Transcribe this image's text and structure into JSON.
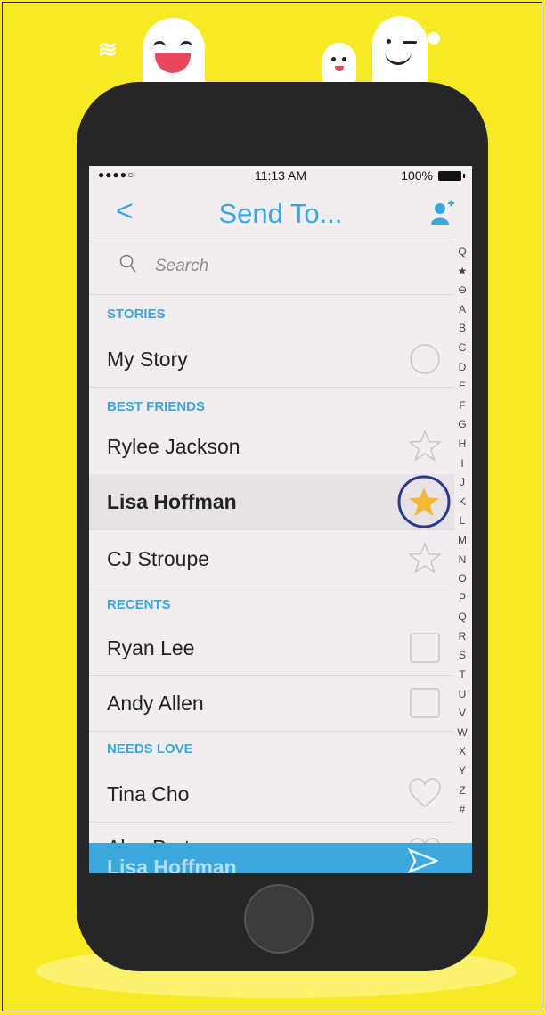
{
  "status_bar": {
    "signal": "●●●●○",
    "time": "11:13 AM",
    "battery": "100%"
  },
  "nav": {
    "back": "<",
    "title": "Send To..."
  },
  "search": {
    "placeholder": "Search"
  },
  "sections": {
    "stories": "STORIES",
    "best_friends": "BEST FRIENDS",
    "recents": "RECENTS",
    "needs_love": "NEEDS LOVE"
  },
  "rows": {
    "my_story": "My Story",
    "rylee": "Rylee Jackson",
    "lisa": "Lisa Hoffman",
    "cj": "CJ Stroupe",
    "ryan": "Ryan Lee",
    "andy": "Andy Allen",
    "tina": "Tina Cho",
    "alex_partial": "Alex Porter"
  },
  "bottom_bar": {
    "selected_partial": "Lisa Hoffman"
  },
  "index_letters": [
    "Q",
    "★",
    "⊖",
    "A",
    "B",
    "C",
    "D",
    "E",
    "F",
    "G",
    "H",
    "I",
    "J",
    "K",
    "L",
    "M",
    "N",
    "O",
    "P",
    "Q",
    "R",
    "S",
    "T",
    "U",
    "V",
    "W",
    "X",
    "Y",
    "Z",
    "#"
  ],
  "colors": {
    "background": "#f7ea24",
    "accent": "#3aa8dc",
    "star_active": "#f5b82e",
    "circle_highlight": "#2b3a8f"
  },
  "icons": {
    "back": "chevron-left-icon",
    "add_friend": "add-friend-icon",
    "search": "search-icon",
    "story_select": "circle-icon",
    "best_friend": "star-icon",
    "recent_select": "checkbox-icon",
    "needs_love": "heart-icon",
    "send": "send-icon"
  }
}
